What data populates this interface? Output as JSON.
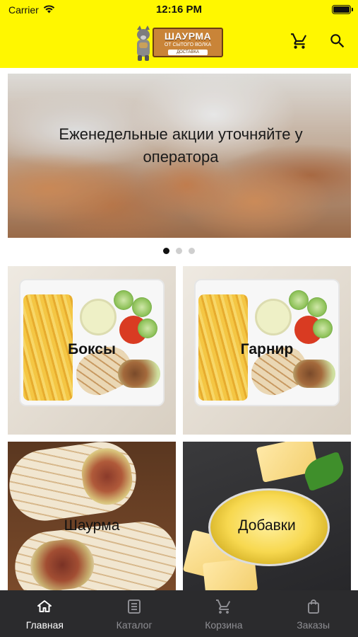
{
  "status_bar": {
    "carrier": "Carrier",
    "time": "12:16 PM"
  },
  "header": {
    "logo": {
      "line1": "ШАУРМА",
      "line2": "ОТ СЫТОГО ВОЛКА",
      "line3": "ДОСТАВКА"
    },
    "icons": [
      "cart-icon",
      "search-icon"
    ]
  },
  "banner": {
    "caption": "Еженедельные акции уточняйте у оператора",
    "slide_count": 3,
    "active_slide": 1
  },
  "categories": [
    {
      "label": "Боксы"
    },
    {
      "label": "Гарнир"
    },
    {
      "label": "Шаурма"
    },
    {
      "label": "Добавки"
    }
  ],
  "tabbar": {
    "items": [
      {
        "label": "Главная",
        "icon": "home-icon",
        "active": true
      },
      {
        "label": "Каталог",
        "icon": "catalog-icon",
        "active": false
      },
      {
        "label": "Корзина",
        "icon": "cart-icon",
        "active": false
      },
      {
        "label": "Заказы",
        "icon": "bag-icon",
        "active": false
      }
    ]
  },
  "colors": {
    "header_bg": "#fff700",
    "tabbar_bg": "#2b2b2d",
    "tab_active": "#ffffff",
    "tab_inactive": "#8e8e93"
  }
}
